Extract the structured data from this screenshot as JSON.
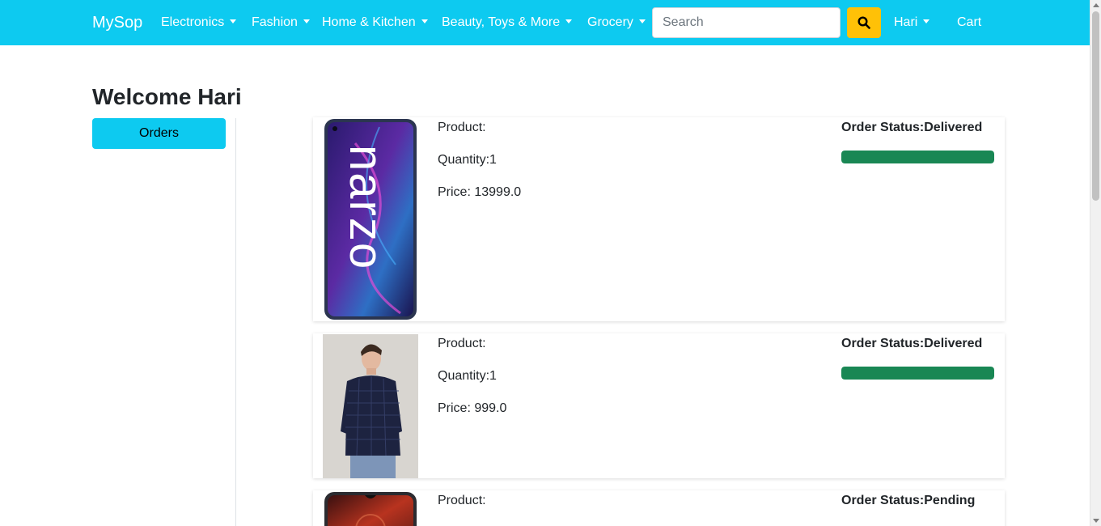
{
  "navbar": {
    "brand": "MySop",
    "menus": [
      "Electronics",
      "Fashion",
      "Home & Kitchen",
      "Beauty, Toys & More",
      "Grocery"
    ],
    "search_placeholder": "Search",
    "search_icon": "search-icon",
    "user": "Hari",
    "cart": "Cart",
    "colors": {
      "bar": "#0dcaf0",
      "search_button": "#ffc107"
    }
  },
  "page": {
    "welcome": "Welcome Hari",
    "orders_button": "Orders"
  },
  "orders": [
    {
      "product": "Product:",
      "quantity": "Quantity:1",
      "price": "Price: 13999.0",
      "status": "Order Status:Delivered",
      "progress": 1.0
    },
    {
      "product": "Product:",
      "quantity": "Quantity:1",
      "price": "Price: 999.0",
      "status": "Order Status:Delivered",
      "progress": 1.0
    },
    {
      "product": "Product:",
      "status": "Order Status:Pending"
    }
  ]
}
